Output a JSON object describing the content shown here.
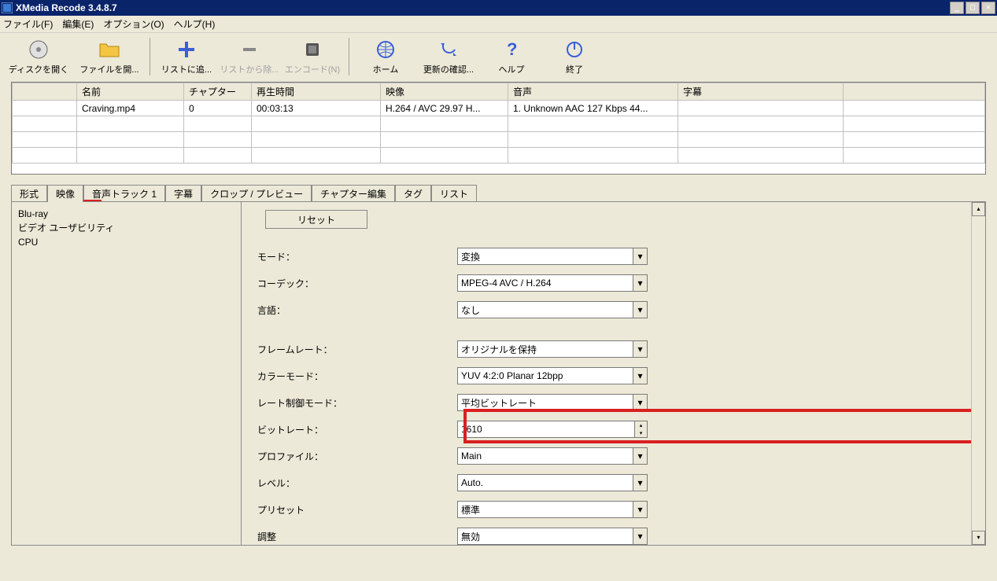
{
  "title": "XMedia Recode 3.4.8.7",
  "menu": {
    "file": "ファイル(F)",
    "edit": "編集(E)",
    "options": "オプション(O)",
    "help": "ヘルプ(H)"
  },
  "toolbar": {
    "open_disc": "ディスクを開く",
    "open_file": "ファイルを開...",
    "add_list": "リストに追...",
    "remove_list": "リストから除...",
    "encode": "エンコード(N)",
    "home": "ホーム",
    "update": "更新の確認...",
    "help": "ヘルプ",
    "exit": "終了"
  },
  "table": {
    "headers": {
      "blank": "",
      "name": "名前",
      "chapter": "チャプター",
      "duration": "再生時間",
      "video": "映像",
      "audio": "音声",
      "subtitle": "字幕"
    },
    "row": {
      "name": "Craving.mp4",
      "chapter": "0",
      "duration": "00:03:13",
      "video": "H.264 / AVC  29.97 H...",
      "audio": "1.  Unknown AAC  127 Kbps 44...",
      "subtitle": ""
    }
  },
  "tabs": [
    "形式",
    "映像",
    "音声トラック 1",
    "字幕",
    "クロップ / プレビュー",
    "チャプター編集",
    "タグ",
    "リスト"
  ],
  "side": [
    "Blu-ray",
    "ビデオ ユーザビリティ",
    "CPU"
  ],
  "reset": "リセット",
  "fields": {
    "mode": {
      "label": "モード：",
      "value": "変換"
    },
    "codec": {
      "label": "コーデック：",
      "value": "MPEG-4 AVC / H.264"
    },
    "lang": {
      "label": "言語：",
      "value": "なし"
    },
    "framerate": {
      "label": "フレームレート：",
      "value": "オリジナルを保持"
    },
    "colormode": {
      "label": "カラーモード：",
      "value": "YUV 4:2:0 Planar 12bpp"
    },
    "ratectl": {
      "label": "レート制御モード：",
      "value": "平均ビットレート"
    },
    "bitrate": {
      "label": "ビットレート：",
      "value": "1610"
    },
    "profile": {
      "label": "プロファイル：",
      "value": "Main"
    },
    "level": {
      "label": "レベル：",
      "value": "Auto."
    },
    "preset": {
      "label": "プリセット",
      "value": "標準"
    },
    "tune": {
      "label": "調整",
      "value": "無効"
    }
  }
}
